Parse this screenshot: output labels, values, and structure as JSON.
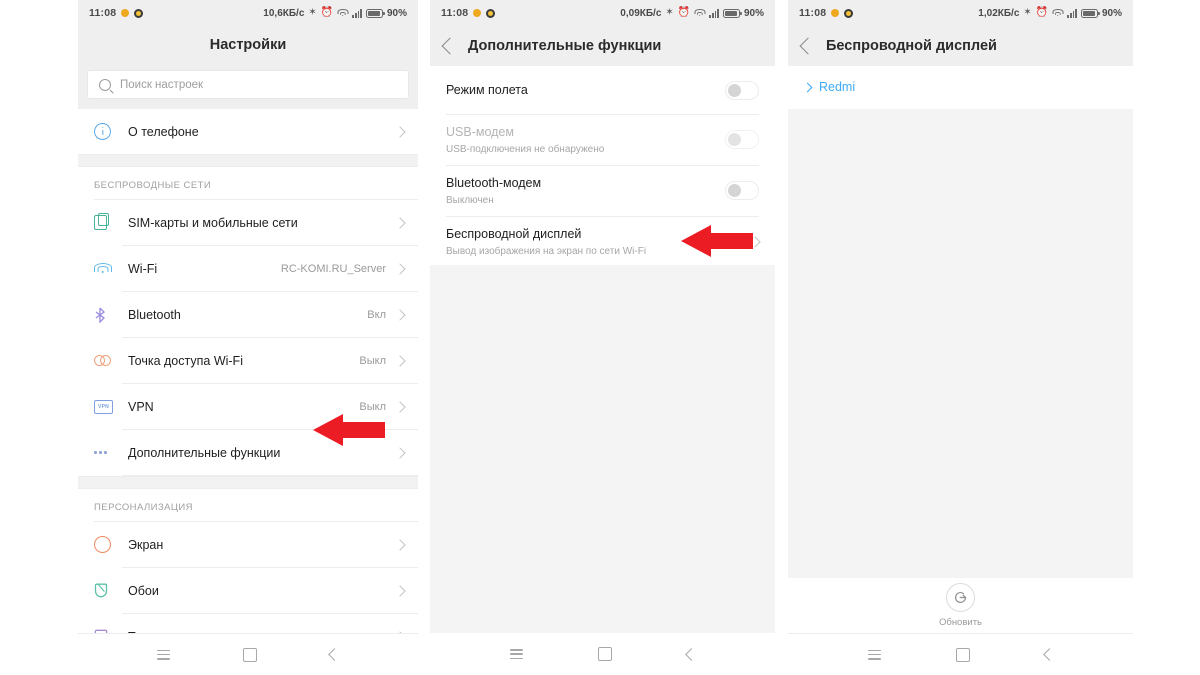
{
  "status_bar": {
    "time": "11:08",
    "speed_p1": "10,6КБ/c",
    "speed_p2": "0,09КБ/c",
    "speed_p3": "1,02КБ/c",
    "battery_pct": "90%"
  },
  "panel1": {
    "title": "Настройки",
    "search_placeholder": "Поиск настроек",
    "items_top": [
      {
        "label": "О телефоне",
        "value": "",
        "icon": "info-icon"
      }
    ],
    "group_wireless": "БЕСПРОВОДНЫЕ СЕТИ",
    "items_wireless": [
      {
        "label": "SIM-карты и мобильные сети",
        "value": "",
        "icon": "sim-card-icon"
      },
      {
        "label": "Wi-Fi",
        "value": "RC-KOMI.RU_Server",
        "icon": "wifi-icon"
      },
      {
        "label": "Bluetooth",
        "value": "Вкл",
        "icon": "bluetooth-icon"
      },
      {
        "label": "Точка доступа Wi-Fi",
        "value": "Выкл",
        "icon": "hotspot-icon"
      },
      {
        "label": "VPN",
        "value": "Выкл",
        "icon": "vpn-icon"
      },
      {
        "label": "Дополнительные функции",
        "value": "",
        "icon": "more-dots-icon"
      }
    ],
    "group_personalization": "ПЕРСОНАЛИЗАЦИЯ",
    "items_personalization": [
      {
        "label": "Экран",
        "value": "",
        "icon": "display-icon"
      },
      {
        "label": "Обои",
        "value": "",
        "icon": "wallpaper-icon"
      },
      {
        "label": "Темы",
        "value": "",
        "icon": "themes-icon"
      }
    ]
  },
  "panel2": {
    "title": "Дополнительные функции",
    "rows": [
      {
        "title": "Режим полета",
        "subtitle": "",
        "control": "toggle-off",
        "dim": false
      },
      {
        "title": "USB-модем",
        "subtitle": "USB-подключения не обнаружено",
        "control": "toggle-off",
        "dim": true
      },
      {
        "title": "Bluetooth-модем",
        "subtitle": "Выключен",
        "control": "toggle-off",
        "dim": false
      },
      {
        "title": "Беспроводной дисплей",
        "subtitle": "Вывод изображения на экран по сети Wi-Fi",
        "control": "chevron",
        "dim": false
      }
    ]
  },
  "panel3": {
    "title": "Беспроводной дисплей",
    "device": "Redmi",
    "refresh_label": "Обновить",
    "refresh_icon": "refresh-icon"
  },
  "navbar": {
    "menu": "menu-icon",
    "home": "home-icon",
    "back": "back-icon"
  },
  "annotations": {
    "arrow_color": "#ec1c24",
    "arrow1_target": "Дополнительные функции",
    "arrow2_target": "Беспроводной дисплей"
  }
}
